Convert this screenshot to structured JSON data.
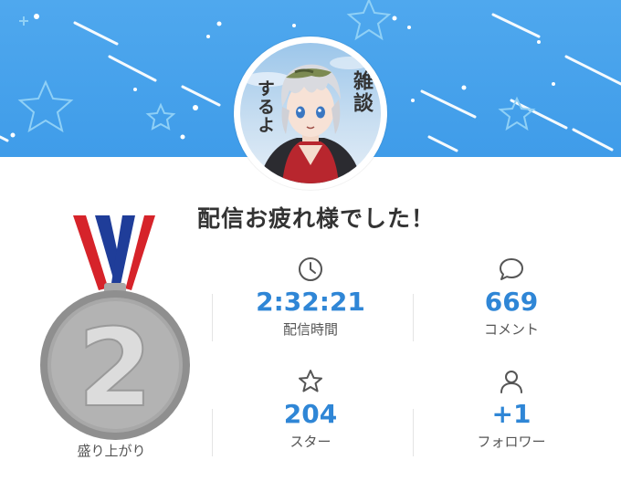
{
  "colors": {
    "banner": "#4aa5ee",
    "accent": "#2f86d6",
    "text": "#333333"
  },
  "avatar": {
    "caption_vertical_1": "雑談",
    "caption_vertical_2": "するよ"
  },
  "title": "配信お疲れ様でした！",
  "medal": {
    "rank": "2",
    "label": "盛り上がり"
  },
  "stats": [
    {
      "icon": "clock-icon",
      "value": "2:32:21",
      "label": "配信時間"
    },
    {
      "icon": "comment-icon",
      "value": "669",
      "label": "コメント"
    },
    {
      "icon": "star-icon",
      "value": "204",
      "label": "スター"
    },
    {
      "icon": "person-icon",
      "value": "+1",
      "label": "フォロワー"
    }
  ]
}
